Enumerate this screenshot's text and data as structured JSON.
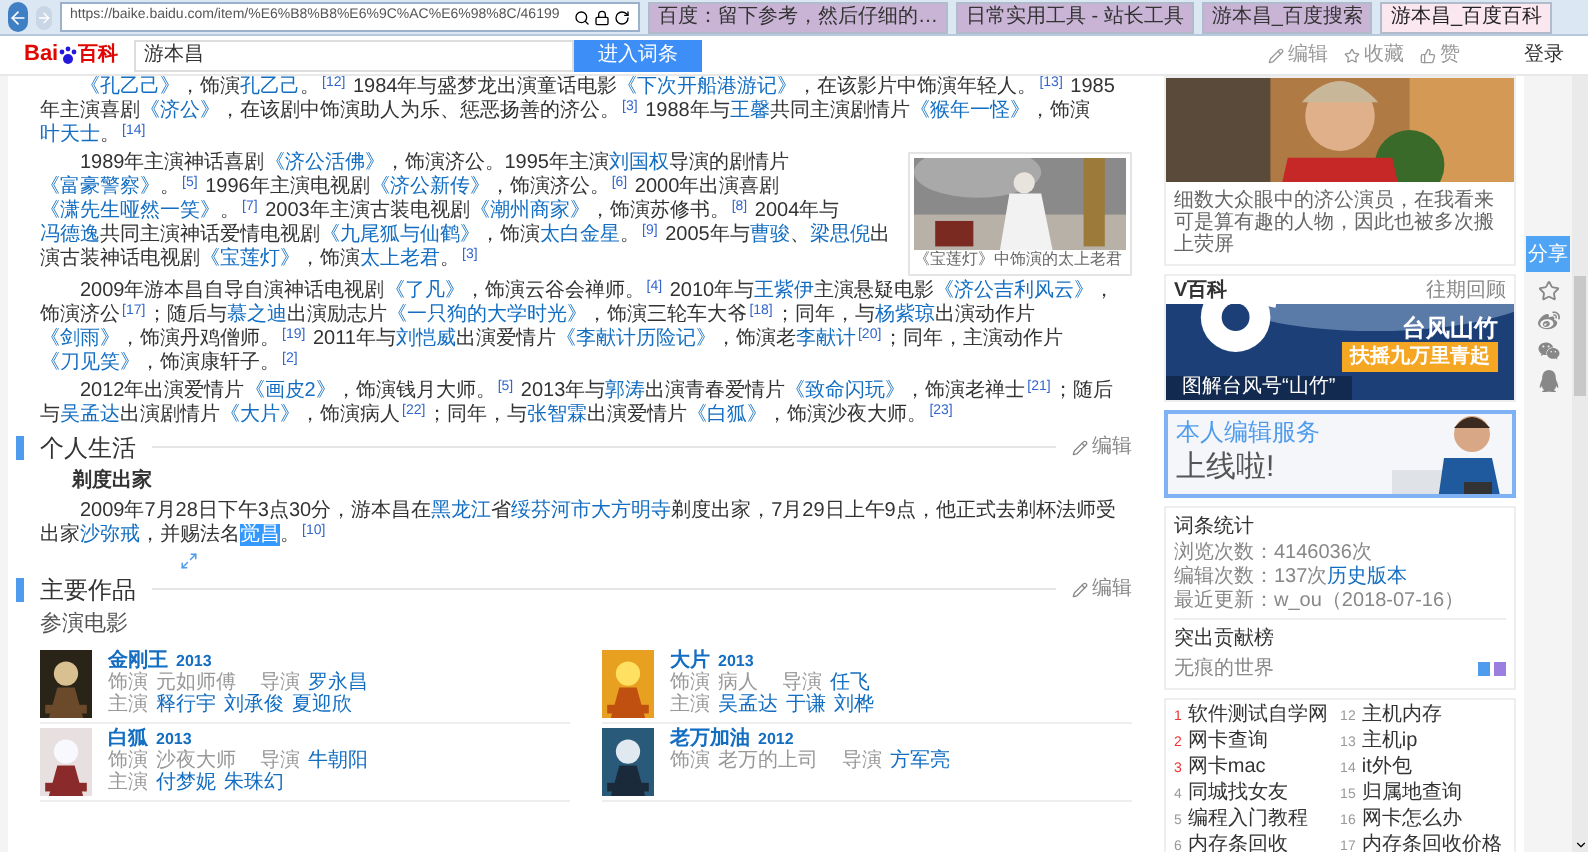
{
  "browser": {
    "url": "https://baike.baidu.com/item/%E6%B8%B8%E6%9C%AC%E6%98%8C/46199",
    "tabs": [
      {
        "title": "百度：留下参考，然后仔细的…",
        "selected": false
      },
      {
        "title": "日常实用工具 - 站长工具",
        "selected": false
      },
      {
        "title": "游本昌_百度搜索",
        "selected": false
      },
      {
        "title": "游本昌_百度百科",
        "selected": true
      }
    ]
  },
  "header": {
    "logo": "Bai",
    "logo_suffix": "百科",
    "search_value": "游本昌",
    "search_button": "进入词条",
    "actions": [
      "编辑",
      "收藏",
      "赞"
    ],
    "login": "登录"
  },
  "career": {
    "paragraphs": [
      [
        {
          "kind": "link",
          "text": "《孔乙己》"
        },
        {
          "kind": "text",
          "text": "，饰演"
        },
        {
          "kind": "link",
          "text": "孔乙己"
        },
        {
          "kind": "text",
          "text": "。"
        },
        {
          "kind": "ref",
          "text": "[12]"
        },
        {
          "kind": "text",
          "text": " 1984年与盛梦龙出演童话电影"
        },
        {
          "kind": "link",
          "text": "《下次开船港游记》"
        },
        {
          "kind": "text",
          "text": "，在该影片中饰演年轻人。"
        },
        {
          "kind": "ref",
          "text": "[13]"
        },
        {
          "kind": "text",
          "text": " 1985年主演喜剧"
        },
        {
          "kind": "link",
          "text": "《济公》"
        },
        {
          "kind": "text",
          "text": "，在该剧中饰演助人为乐、惩恶扬善的济公。"
        },
        {
          "kind": "ref",
          "text": "[3]"
        },
        {
          "kind": "text",
          "text": " 1988年与"
        },
        {
          "kind": "link",
          "text": "王馨"
        },
        {
          "kind": "text",
          "text": "共同主演剧情片"
        },
        {
          "kind": "link",
          "text": "《猴年一怪》"
        },
        {
          "kind": "text",
          "text": "，饰演"
        },
        {
          "kind": "link",
          "text": "叶天士"
        },
        {
          "kind": "text",
          "text": "。"
        },
        {
          "kind": "ref",
          "text": "[14]"
        }
      ],
      [
        {
          "kind": "text",
          "text": "1989年主演神话喜剧"
        },
        {
          "kind": "link",
          "text": "《济公活佛》"
        },
        {
          "kind": "text",
          "text": "，饰演济公。1995年主演"
        },
        {
          "kind": "link",
          "text": "刘国权"
        },
        {
          "kind": "text",
          "text": "导演的剧情片"
        },
        {
          "kind": "link",
          "text": "《富豪警察》"
        },
        {
          "kind": "text",
          "text": "。"
        },
        {
          "kind": "ref",
          "text": "[5]"
        },
        {
          "kind": "text",
          "text": " 1996年主演电视剧"
        },
        {
          "kind": "link",
          "text": "《济公新传》"
        },
        {
          "kind": "text",
          "text": "，饰演济公。"
        },
        {
          "kind": "ref",
          "text": "[6]"
        },
        {
          "kind": "text",
          "text": " 2000年出演喜剧"
        },
        {
          "kind": "link",
          "text": "《潇先生哑然一笑》"
        },
        {
          "kind": "text",
          "text": "。"
        },
        {
          "kind": "ref",
          "text": "[7]"
        },
        {
          "kind": "text",
          "text": " 2003年主演古装电视剧"
        },
        {
          "kind": "link",
          "text": "《潮州商家》"
        },
        {
          "kind": "text",
          "text": "，饰演苏修书。"
        },
        {
          "kind": "ref",
          "text": "[8]"
        },
        {
          "kind": "text",
          "text": " 2004年与"
        },
        {
          "kind": "link",
          "text": "冯德逸"
        },
        {
          "kind": "text",
          "text": "共同主演神话爱情电视剧"
        },
        {
          "kind": "link",
          "text": "《九尾狐与仙鹤》"
        },
        {
          "kind": "text",
          "text": "，饰演"
        },
        {
          "kind": "link",
          "text": "太白金星"
        },
        {
          "kind": "text",
          "text": "。"
        },
        {
          "kind": "ref",
          "text": "[9]"
        },
        {
          "kind": "text",
          "text": " 2005年与"
        },
        {
          "kind": "link",
          "text": "曹骏"
        },
        {
          "kind": "text",
          "text": "、"
        },
        {
          "kind": "link",
          "text": "梁思倪"
        },
        {
          "kind": "text",
          "text": "出演古装神话电视剧"
        },
        {
          "kind": "link",
          "text": "《宝莲灯》"
        },
        {
          "kind": "text",
          "text": "，饰演"
        },
        {
          "kind": "link",
          "text": "太上老君"
        },
        {
          "kind": "text",
          "text": "。"
        },
        {
          "kind": "ref",
          "text": "[3]"
        }
      ],
      [
        {
          "kind": "text",
          "text": "2009年游本昌自导自演神话电视剧"
        },
        {
          "kind": "link",
          "text": "《了凡》"
        },
        {
          "kind": "text",
          "text": "，饰演云谷会禅师。"
        },
        {
          "kind": "ref",
          "text": "[4]"
        },
        {
          "kind": "text",
          "text": " 2010年与"
        },
        {
          "kind": "link",
          "text": "王紫伊"
        },
        {
          "kind": "text",
          "text": "主演悬疑电影"
        },
        {
          "kind": "link",
          "text": "《济公吉利风云》"
        },
        {
          "kind": "text",
          "text": "，饰演济公"
        },
        {
          "kind": "ref",
          "text": "[17]"
        },
        {
          "kind": "text",
          "text": "；随后与"
        },
        {
          "kind": "link",
          "text": "慕之迪"
        },
        {
          "kind": "text",
          "text": "出演励志片"
        },
        {
          "kind": "link",
          "text": "《一只狗的大学时光》"
        },
        {
          "kind": "text",
          "text": "，饰演三轮车大爷"
        },
        {
          "kind": "ref",
          "text": "[18]"
        },
        {
          "kind": "text",
          "text": "；同年，与"
        },
        {
          "kind": "link",
          "text": "杨紫琼"
        },
        {
          "kind": "text",
          "text": "出演动作片"
        },
        {
          "kind": "link",
          "text": "《剑雨》"
        },
        {
          "kind": "text",
          "text": "，饰演丹鸡僧师。"
        },
        {
          "kind": "ref",
          "text": "[19]"
        },
        {
          "kind": "text",
          "text": " 2011年与"
        },
        {
          "kind": "link",
          "text": "刘恺威"
        },
        {
          "kind": "text",
          "text": "出演爱情片"
        },
        {
          "kind": "link",
          "text": "《李献计历险记》"
        },
        {
          "kind": "text",
          "text": "，饰演老"
        },
        {
          "kind": "link",
          "text": "李献计"
        },
        {
          "kind": "ref",
          "text": "[20]"
        },
        {
          "kind": "text",
          "text": "；同年，主演动作片"
        },
        {
          "kind": "link",
          "text": "《刀见笑》"
        },
        {
          "kind": "text",
          "text": "，饰演康轩子。"
        },
        {
          "kind": "ref",
          "text": "[2]"
        }
      ],
      [
        {
          "kind": "text",
          "text": "2012年出演爱情片"
        },
        {
          "kind": "link",
          "text": "《画皮2》"
        },
        {
          "kind": "text",
          "text": "，饰演钱月大师。"
        },
        {
          "kind": "ref",
          "text": "[5]"
        },
        {
          "kind": "text",
          "text": " 2013年与"
        },
        {
          "kind": "link",
          "text": "郭涛"
        },
        {
          "kind": "text",
          "text": "出演青春爱情片"
        },
        {
          "kind": "link",
          "text": "《致命闪玩》"
        },
        {
          "kind": "text",
          "text": "，饰演老禅士"
        },
        {
          "kind": "ref",
          "text": "[21]"
        },
        {
          "kind": "text",
          "text": "；随后与"
        },
        {
          "kind": "link",
          "text": "吴孟达"
        },
        {
          "kind": "text",
          "text": "出演剧情片"
        },
        {
          "kind": "link",
          "text": "《大片》"
        },
        {
          "kind": "text",
          "text": "，饰演病人"
        },
        {
          "kind": "ref",
          "text": "[22]"
        },
        {
          "kind": "text",
          "text": "；同年，与"
        },
        {
          "kind": "link",
          "text": "张智霖"
        },
        {
          "kind": "text",
          "text": "出演爱情片"
        },
        {
          "kind": "link",
          "text": "《白狐》"
        },
        {
          "kind": "text",
          "text": "，饰演沙夜大师。"
        },
        {
          "kind": "ref",
          "text": "[23]"
        }
      ]
    ],
    "figure": {
      "kind": "picture",
      "caption": "《宝莲灯》中饰演的太上老君"
    }
  },
  "personal": {
    "heading": "个人生活",
    "edit": "编辑",
    "subheading": "剃度出家",
    "paragraph": [
      {
        "kind": "text",
        "text": "2009年7月28日下午3点30分，游本昌在"
      },
      {
        "kind": "link",
        "text": "黑龙江"
      },
      {
        "kind": "text",
        "text": "省"
      },
      {
        "kind": "link",
        "text": "绥芬河市大方明寺"
      },
      {
        "kind": "text",
        "text": "剃度出家，7月29日上午9点，他正式去剃杯法师受出家"
      },
      {
        "kind": "link",
        "text": "沙弥戒"
      },
      {
        "kind": "text",
        "text": "，并赐法名"
      },
      {
        "kind": "highlight",
        "text": "觉昌"
      },
      {
        "kind": "text",
        "text": "。"
      },
      {
        "kind": "ref",
        "text": "[10]"
      }
    ]
  },
  "works": {
    "heading": "主要作品",
    "edit": "编辑",
    "subheading": "参演电影",
    "movies": [
      {
        "title": "金刚王",
        "year": "2013",
        "role_label": "饰演",
        "role": "元如师傅",
        "director_label": "导演",
        "director": "罗永昌",
        "cast_label": "主演",
        "cast": [
          "释行宇",
          "刘承俊",
          "夏迎欣"
        ]
      },
      {
        "title": "大片",
        "year": "2013",
        "role_label": "饰演",
        "role": "病人",
        "director_label": "导演",
        "director": "任飞",
        "cast_label": "主演",
        "cast": [
          "吴孟达",
          "于谦",
          "刘桦"
        ]
      },
      {
        "title": "白狐",
        "year": "2013",
        "role_label": "饰演",
        "role": "沙夜大师",
        "director_label": "导演",
        "director": "牛朝阳",
        "cast_label": "主演",
        "cast": [
          "付梦妮",
          "朱珠幻"
        ]
      },
      {
        "title": "老万加油",
        "year": "2012",
        "role_label": "饰演",
        "role": "老万的上司",
        "director_label": "导演",
        "director": "方军亮"
      }
    ]
  },
  "sidebar": {
    "photo_text": "细数大众眼中的济公演员，在我看来可是算有趣的人物，因此也被多次搬上荧屏",
    "vbaike": {
      "title": "V百科",
      "link": "往期回顾",
      "headline": "台风山竹",
      "tagline": "扶摇九万里青起",
      "caption": "图解台风号“山竹”"
    },
    "ad": {
      "line1": "本人编辑服务",
      "line2": "上线啦!"
    },
    "stats": {
      "title": "词条统计",
      "rows": [
        {
          "label": "浏览次数：",
          "value": "4146036次"
        },
        {
          "label": "编辑次数：",
          "value": "137次",
          "link": "历史版本"
        },
        {
          "label": "最近更新：",
          "value": "w_ou（2018-07-16）"
        }
      ],
      "contrib_title": "突出贡献榜",
      "contributor": "无痕的世界"
    },
    "hot": [
      {
        "rank": "1",
        "text": "软件测试自学网",
        "highlighted": true
      },
      {
        "rank": "12",
        "text": "主机内存",
        "highlighted": false
      },
      {
        "rank": "2",
        "text": "网卡查询",
        "highlighted": true
      },
      {
        "rank": "13",
        "text": "主机ip",
        "highlighted": false
      },
      {
        "rank": "3",
        "text": "网卡mac",
        "highlighted": true
      },
      {
        "rank": "14",
        "text": "it外包",
        "highlighted": false
      },
      {
        "rank": "4",
        "text": "同城找女友",
        "highlighted": false
      },
      {
        "rank": "15",
        "text": "归属地查询",
        "highlighted": false
      },
      {
        "rank": "5",
        "text": "编程入门教程",
        "highlighted": false
      },
      {
        "rank": "16",
        "text": "网卡怎么办",
        "highlighted": false
      },
      {
        "rank": "6",
        "text": "内存条回收",
        "highlighted": false
      },
      {
        "rank": "17",
        "text": "内存条回收价格",
        "highlighted": false
      }
    ]
  },
  "share": {
    "label": "分享"
  }
}
